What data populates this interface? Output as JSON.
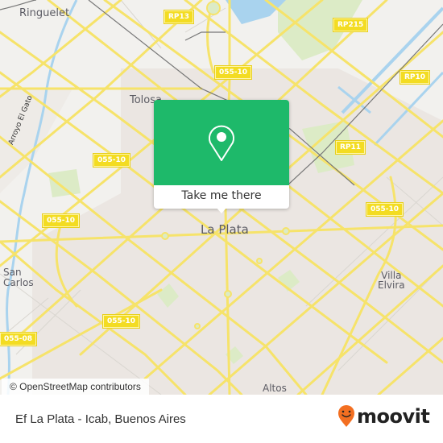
{
  "map": {
    "colors": {
      "background": "#f2f1ee",
      "urban_area": "#ebe6e2",
      "park": "#dcebc6",
      "water": "#a9d3ee",
      "road_major": "#f6e36a",
      "road_minor": "#d9d6d0",
      "railway": "#777777",
      "shield": "#f3dc22"
    },
    "place_labels": [
      {
        "name": "ringuelet",
        "text": "Ringuelet"
      },
      {
        "name": "tolosa",
        "text": "Tolosa"
      },
      {
        "name": "la-plata",
        "text": "La Plata"
      },
      {
        "name": "san-carlos",
        "text": "San\nCarlos"
      },
      {
        "name": "villa-elvira",
        "text": "Villa\nElvira"
      },
      {
        "name": "altos",
        "text": "Altos"
      },
      {
        "name": "arroyo-el-gato",
        "text": "Arroyo El Gato"
      }
    ],
    "road_shields": [
      {
        "name": "rp13",
        "text": "RP13"
      },
      {
        "name": "rp215",
        "text": "RP215"
      },
      {
        "name": "rp10",
        "text": "RP10"
      },
      {
        "name": "055-10-north",
        "text": "055-10"
      },
      {
        "name": "rp11",
        "text": "RP11"
      },
      {
        "name": "055-10-west-upper",
        "text": "055-10"
      },
      {
        "name": "055-10-west",
        "text": "055-10"
      },
      {
        "name": "055-10-east",
        "text": "055-10"
      },
      {
        "name": "055-10-south",
        "text": "055-10"
      },
      {
        "name": "055-08",
        "text": "055-08"
      }
    ],
    "attribution": "© OpenStreetMap contributors"
  },
  "popup": {
    "icon": "map-pin-icon",
    "cta_label": "Take me there",
    "accent": "#1eb96a"
  },
  "footer": {
    "title": "Ef La Plata - Icab, Buenos Aires",
    "logo_text": "moovit",
    "logo_icon": "moovit-smile-pin-icon",
    "logo_accent": "#f36f21"
  }
}
